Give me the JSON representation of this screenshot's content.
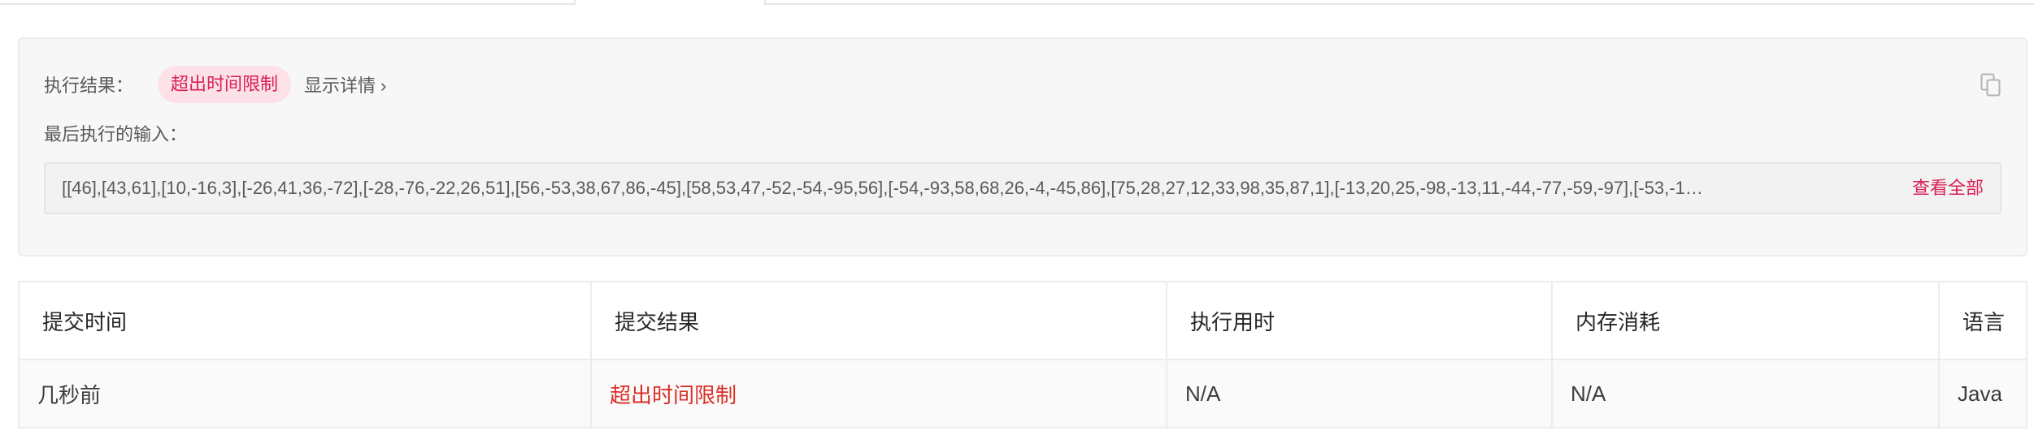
{
  "result": {
    "label": "执行结果：",
    "status": "超出时间限制",
    "details_link": "显示详情",
    "details_chevron": "›",
    "last_input_label": "最后执行的输入：",
    "last_input_value": "[[46],[43,61],[10,-16,3],[-26,41,36,-72],[-28,-76,-22,26,51],[56,-53,38,67,86,-45],[58,53,47,-52,-54,-95,56],[-54,-93,58,68,26,-4,-45,86],[75,28,27,12,33,98,35,87,1],[-13,20,25,-98,-13,11,-44,-77,-59,-97],[-53,-1…",
    "view_all": "查看全部",
    "copy_icon": "copy-icon"
  },
  "table": {
    "headers": [
      "提交时间",
      "提交结果",
      "执行用时",
      "内存消耗",
      "语言"
    ],
    "rows": [
      {
        "submitted": "几秒前",
        "status": "超出时间限制",
        "runtime": "N/A",
        "memory": "N/A",
        "language": "Java"
      }
    ]
  },
  "colors": {
    "accent": "#d92155",
    "status_pill_bg": "#fde1e8",
    "error_text": "#d93025",
    "panel_bg": "#f7f7f7"
  }
}
